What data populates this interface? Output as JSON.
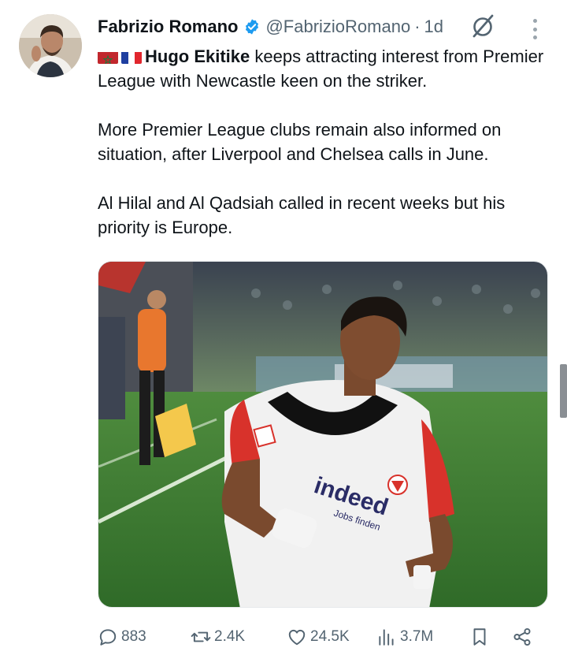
{
  "author": {
    "name": "Fabrizio Romano",
    "handle": "@FabrizioRomano",
    "separator": "·",
    "time": "1d",
    "verified": true
  },
  "tweet": {
    "player_name": "Hugo Ekitike",
    "line1_rest": " keeps attracting interest from Premier League with Newcastle keen on the striker.",
    "paragraph2": "More Premier League clubs remain also informed on situation, after Liverpool and Chelsea calls in June.",
    "paragraph3": "Al Hilal and Al Qadsiah called in recent weeks but his priority is Europe.",
    "flags": [
      "morocco-flag-icon",
      "france-flag-icon"
    ]
  },
  "media": {
    "shirt_sponsor": "indeed",
    "shirt_sponsor_tagline": "Jobs finden"
  },
  "actions": {
    "replies": "883",
    "reposts": "2.4K",
    "likes": "24.5K",
    "views": "3.7M"
  },
  "colors": {
    "text": "#0f1419",
    "secondary": "#536471",
    "verified": "#1d9bf0",
    "pitch": "#3f7a34",
    "shirt_red": "#d8322b"
  }
}
